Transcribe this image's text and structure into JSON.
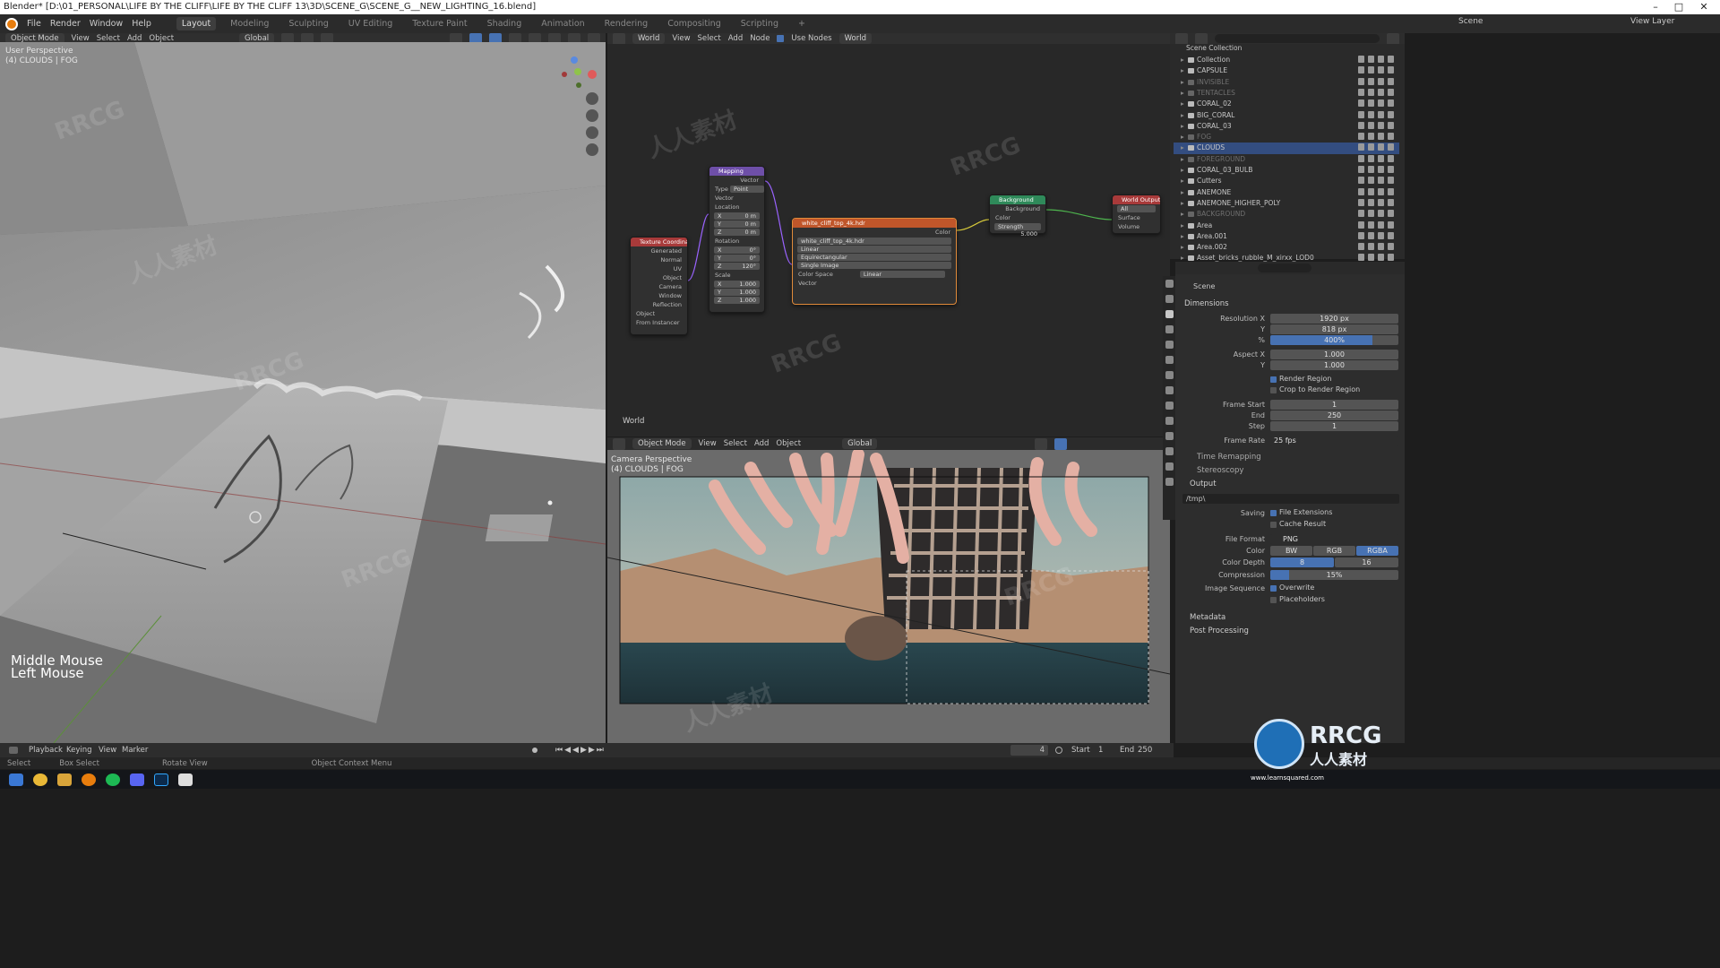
{
  "window": {
    "title": "Blender* [D:\\01_PERSONAL\\LIFE BY THE CLIFF\\LIFE BY THE CLIFF 13\\3D\\SCENE_G\\SCENE_G__NEW_LIGHTING_16.blend]",
    "minimize": "–",
    "maximize": "□",
    "close": "✕"
  },
  "topbar": {
    "menus": [
      "File",
      "Render",
      "Window",
      "Help"
    ],
    "workspaces": [
      "Layout",
      "Modeling",
      "Sculpting",
      "UV Editing",
      "Texture Paint",
      "Shading",
      "Animation",
      "Rendering",
      "Compositing",
      "Scripting",
      "+"
    ],
    "active_workspace": "Layout",
    "scene": "Scene",
    "view_layer": "View Layer"
  },
  "viewport3d": {
    "mode": "Object Mode",
    "menus": [
      "View",
      "Select",
      "Add",
      "Object"
    ],
    "transform": "Global",
    "perspective_label": "User Perspective",
    "collection_label": "(4) CLOUDS | FOG",
    "overlay_text_1": "Middle Mouse",
    "overlay_text_2": "Left Mouse"
  },
  "node_editor": {
    "world_type": "World",
    "menus": [
      "View",
      "Select",
      "Add",
      "Node"
    ],
    "use_nodes": "Use Nodes",
    "world_name": "World",
    "footer_label": "World",
    "nodes": {
      "texcoord": {
        "title": "Texture Coordinate",
        "outputs": [
          "Generated",
          "Normal",
          "UV",
          "Object",
          "Camera",
          "Window",
          "Reflection"
        ],
        "object_label": "Object",
        "from_instancer": "From Instancer"
      },
      "mapping": {
        "title": "Mapping",
        "vector_out": "Vector",
        "type_label": "Type",
        "type_value": "Point",
        "vector_in": "Vector",
        "location": "Location",
        "loc": [
          [
            "X",
            "0 m"
          ],
          [
            "Y",
            "0 m"
          ],
          [
            "Z",
            "0 m"
          ]
        ],
        "rotation": "Rotation",
        "rot": [
          [
            "X",
            "0°"
          ],
          [
            "Y",
            "0°"
          ],
          [
            "Z",
            "120°"
          ]
        ],
        "scale": "Scale",
        "scl": [
          [
            "X",
            "1.000"
          ],
          [
            "Y",
            "1.000"
          ],
          [
            "Z",
            "1.000"
          ]
        ]
      },
      "envtex": {
        "title": "white_cliff_top_4k.hdr",
        "color_out": "Color",
        "image": "white_cliff_top_4k.hdr",
        "interp": "Linear",
        "projection": "Equirectangular",
        "source": "Single Image",
        "colorspace_label": "Color Space",
        "colorspace_value": "Linear",
        "vector_in": "Vector"
      },
      "background": {
        "title": "Background",
        "out": "Background",
        "color": "Color",
        "strength_label": "Strength",
        "strength_value": "5.000"
      },
      "output": {
        "title": "World Output",
        "target": "All",
        "surface": "Surface",
        "volume": "Volume"
      }
    }
  },
  "camera_view": {
    "mode": "Object Mode",
    "menus": [
      "View",
      "Select",
      "Add",
      "Object"
    ],
    "transform": "Global",
    "perspective_label": "Camera Perspective",
    "collection_label": "(4) CLOUDS | FOG"
  },
  "outliner": {
    "root": "Scene Collection",
    "items": [
      {
        "name": "Collection",
        "dim": false,
        "selected": false
      },
      {
        "name": "CAPSULE",
        "dim": false,
        "selected": false
      },
      {
        "name": "INVISIBLE",
        "dim": true,
        "selected": false
      },
      {
        "name": "TENTACLES",
        "dim": true,
        "selected": false
      },
      {
        "name": "CORAL_02",
        "dim": false,
        "selected": false
      },
      {
        "name": "BIG_CORAL",
        "dim": false,
        "selected": false
      },
      {
        "name": "CORAL_03",
        "dim": false,
        "selected": false
      },
      {
        "name": "FOG",
        "dim": true,
        "selected": false
      },
      {
        "name": "CLOUDS",
        "dim": false,
        "selected": true
      },
      {
        "name": "FOREGROUND",
        "dim": true,
        "selected": false
      },
      {
        "name": "CORAL_03_BULB",
        "dim": false,
        "selected": false
      },
      {
        "name": "Cutters",
        "dim": false,
        "selected": false
      },
      {
        "name": "ANEMONE",
        "dim": false,
        "selected": false
      },
      {
        "name": "ANEMONE_HIGHER_POLY",
        "dim": false,
        "selected": false
      },
      {
        "name": "BACKGROUND",
        "dim": true,
        "selected": false
      },
      {
        "name": "Area",
        "dim": false,
        "selected": false
      },
      {
        "name": "Area.001",
        "dim": false,
        "selected": false
      },
      {
        "name": "Area.002",
        "dim": false,
        "selected": false
      },
      {
        "name": "Asset_bricks_rubble_M_xirxx_LOD0",
        "dim": false,
        "selected": false
      }
    ]
  },
  "properties": {
    "scene": "Scene",
    "dimensions": "Dimensions",
    "resolution_x_label": "Resolution X",
    "resolution_x": "1920 px",
    "resolution_y_label": "Y",
    "resolution_y": "818 px",
    "percent_label": "%",
    "percent": "400%",
    "percent_fill": 0.8,
    "aspect_x_label": "Aspect X",
    "aspect_x": "1.000",
    "aspect_y_label": "Y",
    "aspect_y": "1.000",
    "render_region": "Render Region",
    "crop_region": "Crop to Render Region",
    "frame_start_label": "Frame Start",
    "frame_start": "1",
    "frame_end_label": "End",
    "frame_end": "250",
    "frame_step_label": "Step",
    "frame_step": "1",
    "frame_rate_label": "Frame Rate",
    "frame_rate": "25 fps",
    "time_remapping": "Time Remapping",
    "stereoscopy": "Stereoscopy",
    "output": "Output",
    "output_path": "/tmp\\",
    "saving_label": "Saving",
    "file_extensions": "File Extensions",
    "cache_result": "Cache Result",
    "file_format_label": "File Format",
    "file_format": "PNG",
    "color_label": "Color",
    "color_opts": [
      "BW",
      "RGB",
      "RGBA"
    ],
    "color_depth_label": "Color Depth",
    "color_depth_opts": [
      "8",
      "16"
    ],
    "compression_label": "Compression",
    "compression": "15%",
    "compression_fill": 0.15,
    "image_sequence_label": "Image Sequence",
    "overwrite": "Overwrite",
    "placeholders": "Placeholders",
    "metadata": "Metadata",
    "post_processing": "Post Processing"
  },
  "timeline": {
    "menus": [
      "Playback",
      "Keying",
      "View",
      "Marker"
    ],
    "current_frame": "4",
    "start_label": "Start",
    "start": "1",
    "end_label": "End",
    "end": "250"
  },
  "statusbar": {
    "select": "Select",
    "box_select": "Box Select",
    "rotate_view": "Rotate View",
    "context_menu": "Object Context Menu"
  },
  "watermark": {
    "brand": "RRCG",
    "chinese": "人人素材",
    "url": "www.learnsquared.com"
  },
  "colors": {
    "accent": "#4772b3",
    "node_mapping": "#6e4fa8",
    "node_texcoord": "#a83a3a",
    "node_envtex": "#c0562a",
    "node_background": "#2f8a5a",
    "node_output": "#a83a3a"
  }
}
